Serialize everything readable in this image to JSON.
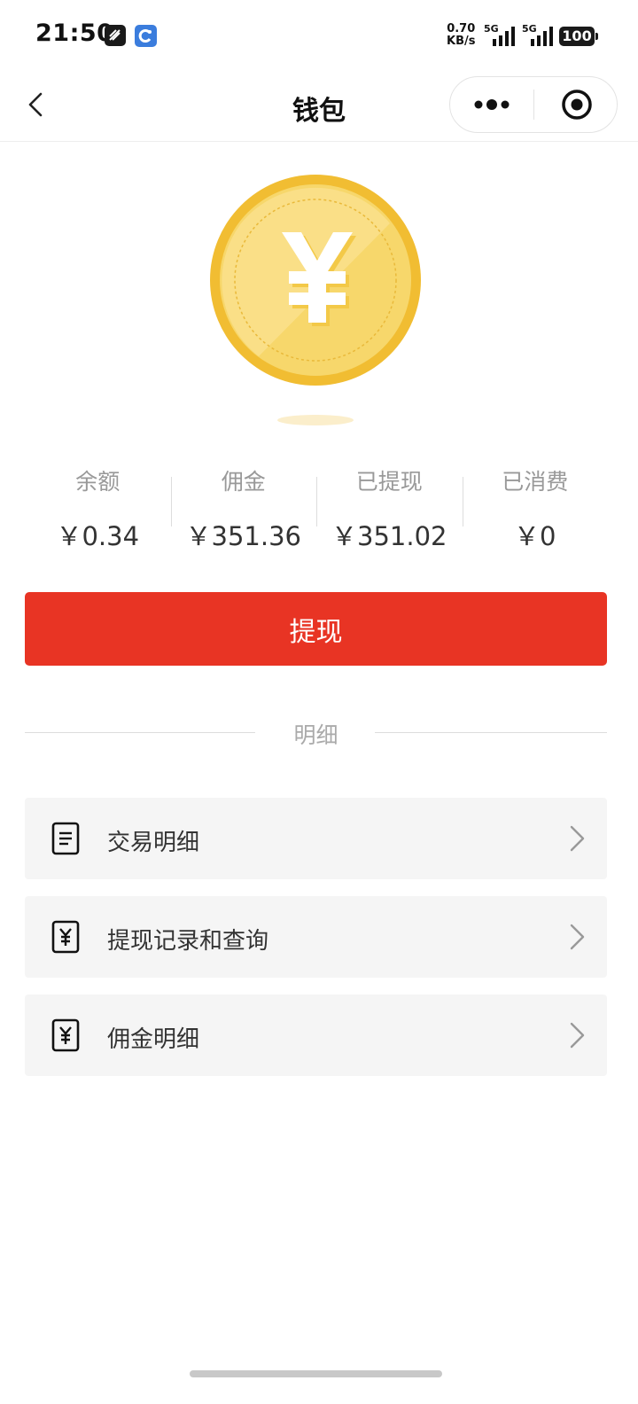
{
  "status_bar": {
    "time": "21:50",
    "net_speed_value": "0.70",
    "net_speed_unit": "KB/s",
    "sim1_label": "5G",
    "sim2_label": "5G",
    "battery": "100"
  },
  "nav": {
    "title": "钱包"
  },
  "stats": [
    {
      "label": "余额",
      "value": "￥0.34"
    },
    {
      "label": "佣金",
      "value": "￥351.36"
    },
    {
      "label": "已提现",
      "value": "￥351.02"
    },
    {
      "label": "已消费",
      "value": "￥0"
    }
  ],
  "withdraw_button": "提现",
  "section_title": "明细",
  "menu": [
    {
      "label": "交易明细",
      "icon": "document-icon"
    },
    {
      "label": "提现记录和查询",
      "icon": "yuan-receipt-icon"
    },
    {
      "label": "佣金明细",
      "icon": "yuan-receipt-icon"
    }
  ],
  "colors": {
    "accent": "#e83424",
    "coin": "#f5c640"
  }
}
